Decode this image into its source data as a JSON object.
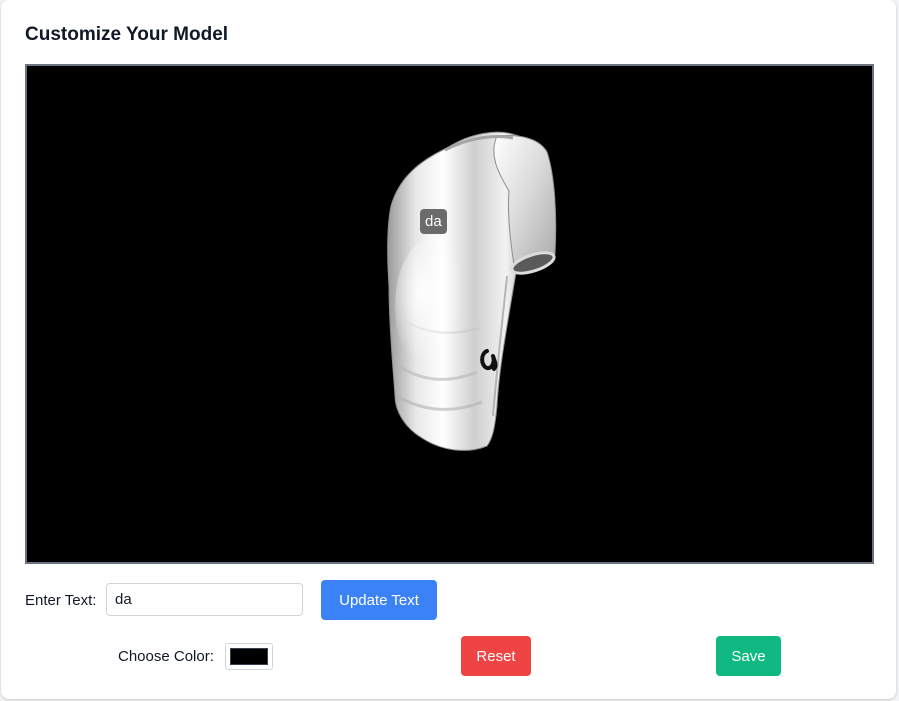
{
  "title": "Customize Your Model",
  "viewer": {
    "decal_text": "da",
    "background": "#000000",
    "model": "t-shirt"
  },
  "form": {
    "text_label": "Enter Text:",
    "text_value": "da",
    "update_button": "Update Text",
    "color_label": "Choose Color:",
    "color_value": "#000000",
    "reset_button": "Reset",
    "save_button": "Save"
  },
  "colors": {
    "update": "#3b82f6",
    "reset": "#ef4444",
    "save": "#10b981"
  }
}
